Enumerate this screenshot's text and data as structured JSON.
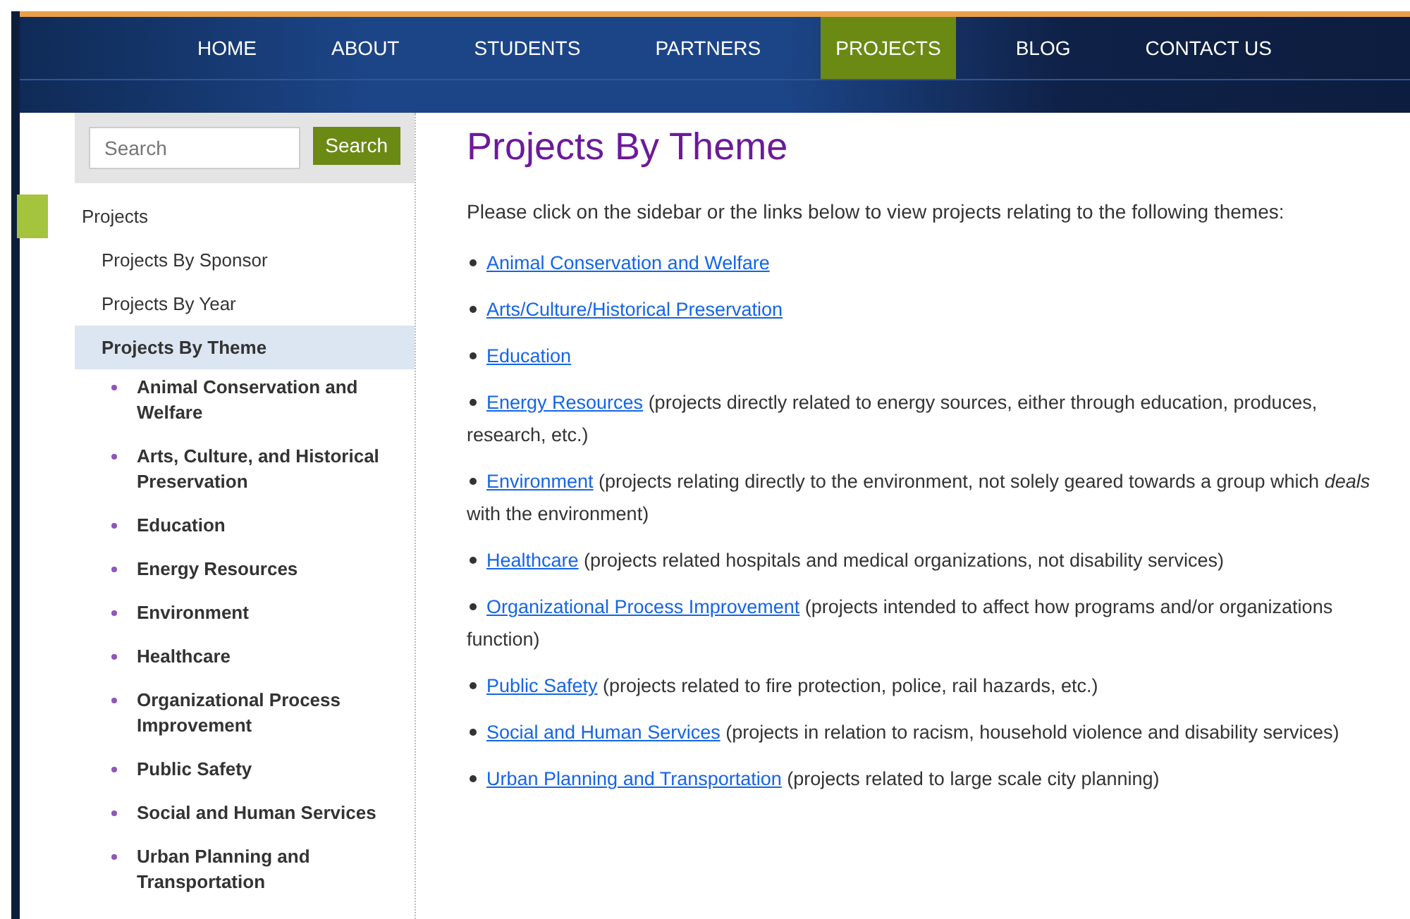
{
  "nav": {
    "items": [
      {
        "label": "HOME",
        "selected": false
      },
      {
        "label": "ABOUT",
        "selected": false
      },
      {
        "label": "STUDENTS",
        "selected": false
      },
      {
        "label": "PARTNERS",
        "selected": false
      },
      {
        "label": "PROJECTS",
        "selected": true
      },
      {
        "label": "BLOG",
        "selected": false
      },
      {
        "label": "CONTACT US",
        "selected": false
      }
    ]
  },
  "search": {
    "placeholder": "Search",
    "button": "Search"
  },
  "sidebar": {
    "items": [
      {
        "label": "Projects",
        "current_section": true,
        "selected": false,
        "children": [
          {
            "label": "Projects By Sponsor",
            "selected": false
          },
          {
            "label": "Projects By Year",
            "selected": false
          },
          {
            "label": "Projects By Theme",
            "selected": true,
            "children": [
              {
                "label": "Animal Conservation and Welfare"
              },
              {
                "label": "Arts, Culture, and Historical Preservation"
              },
              {
                "label": "Education"
              },
              {
                "label": "Energy Resources"
              },
              {
                "label": "Environment"
              },
              {
                "label": "Healthcare"
              },
              {
                "label": "Organizational Process Improvement"
              },
              {
                "label": "Public Safety"
              },
              {
                "label": "Social and Human Services"
              },
              {
                "label": "Urban Planning and Transportation"
              }
            ]
          }
        ]
      }
    ]
  },
  "page": {
    "title": "Projects By Theme",
    "intro": "Please click on the sidebar or the links below to view projects relating to the following themes:",
    "themes": [
      {
        "link": "Animal Conservation and Welfare"
      },
      {
        "link": "Arts/Culture/Historical Preservation"
      },
      {
        "link": "Education"
      },
      {
        "link": "Energy Resources",
        "note": "(projects directly related to energy sources, either through education, produces, research, etc.)"
      },
      {
        "link": "Environment",
        "note": "(projects relating directly to the environment, not solely geared towards a group which *deals* with the environment)"
      },
      {
        "link": "Healthcare",
        "note": "(projects related hospitals and medical organizations, not disability services)"
      },
      {
        "link": "Organizational Process Improvement",
        "note": "(projects intended to affect how programs and/or organizations function)"
      },
      {
        "link": "Public Safety",
        "note": "(projects related to fire protection, police, rail hazards, etc.)"
      },
      {
        "link": "Social and Human Services",
        "note": "(projects in relation to racism, household violence and disability services)"
      },
      {
        "link": "Urban Planning and Transportation",
        "note": "(projects related to large scale city planning)"
      }
    ]
  }
}
